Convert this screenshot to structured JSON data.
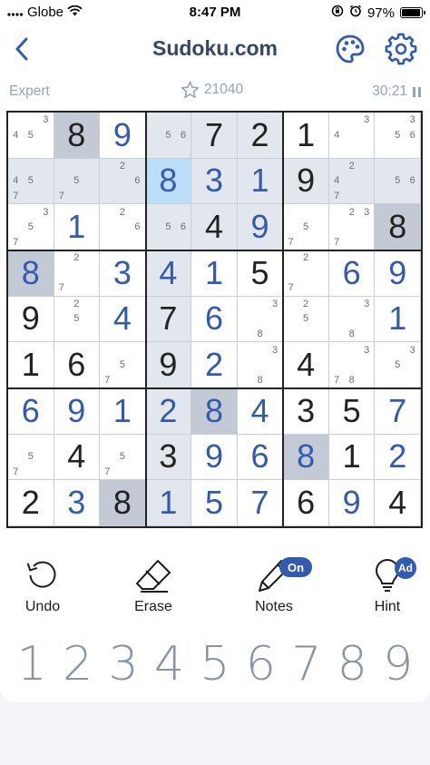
{
  "status_bar": {
    "carrier": "Globe",
    "time": "8:47 PM",
    "battery": "97%",
    "battery_level": 0.97
  },
  "header": {
    "title_main": "Sudoku",
    "title_dot": ".",
    "title_tld": "com"
  },
  "info": {
    "difficulty": "Expert",
    "score": "21040",
    "timer": "30:21"
  },
  "colors": {
    "brand": "#325aaf",
    "given": "#222222",
    "user": "#325aaf",
    "highlight": "#e2e7ed",
    "selected": "#bbdefb",
    "same_number": "#c3cad6"
  },
  "board": {
    "cells": [
      [
        {
          "notes": [
            "4",
            "5",
            "",
            "",
            "",
            "",
            ""
          ],
          "n3": "3"
        },
        {
          "v": "8",
          "t": "given"
        },
        {
          "v": "9",
          "t": "user"
        },
        {
          "notes6": [
            "5",
            "6"
          ]
        },
        {
          "v": "7",
          "t": "given"
        },
        {
          "v": "2",
          "t": "given"
        },
        {
          "v": "1",
          "t": "given"
        },
        {
          "notes": [
            "4"
          ],
          "n3": "3"
        },
        {
          "n3": "3",
          "notes6": [
            "5",
            "6"
          ]
        }
      ],
      [
        {
          "full": "4 5 7"
        },
        {
          "full": "5 7"
        },
        {
          "full": "2 6"
        },
        {
          "v": "8",
          "t": "user"
        },
        {
          "v": "3",
          "t": "user"
        },
        {
          "v": "1",
          "t": "user"
        },
        {
          "v": "9",
          "t": "given"
        },
        {
          "full": "2 4 7"
        },
        {
          "full": "5 6"
        }
      ],
      [
        {
          "full": "3 5 7"
        },
        {
          "v": "1",
          "t": "user"
        },
        {
          "full": "2 6"
        },
        {
          "full": "5 6"
        },
        {
          "v": "4",
          "t": "given"
        },
        {
          "v": "9",
          "t": "user"
        },
        {
          "full": "5 7"
        },
        {
          "full": "2 3 7"
        },
        {
          "v": "8",
          "t": "given"
        }
      ],
      [
        {
          "v": "8",
          "t": "user"
        },
        {
          "full": "2 7"
        },
        {
          "v": "3",
          "t": "user"
        },
        {
          "v": "4",
          "t": "user"
        },
        {
          "v": "1",
          "t": "user"
        },
        {
          "v": "5",
          "t": "given"
        },
        {
          "full": "2 7"
        },
        {
          "v": "6",
          "t": "user"
        },
        {
          "v": "9",
          "t": "user"
        }
      ],
      [
        {
          "v": "9",
          "t": "given"
        },
        {
          "full": "2 5"
        },
        {
          "v": "4",
          "t": "user"
        },
        {
          "v": "7",
          "t": "given"
        },
        {
          "v": "6",
          "t": "user"
        },
        {
          "full": "3 8"
        },
        {
          "full": "2 5"
        },
        {
          "full": "3 8"
        },
        {
          "v": "1",
          "t": "user"
        }
      ],
      [
        {
          "v": "1",
          "t": "given"
        },
        {
          "v": "6",
          "t": "given"
        },
        {
          "full": "5 7"
        },
        {
          "v": "9",
          "t": "given"
        },
        {
          "v": "2",
          "t": "user"
        },
        {
          "full": "3 8"
        },
        {
          "v": "4",
          "t": "given"
        },
        {
          "full": "3 7 8"
        },
        {
          "full": "3 5"
        }
      ],
      [
        {
          "v": "6",
          "t": "user"
        },
        {
          "v": "9",
          "t": "user"
        },
        {
          "v": "1",
          "t": "user"
        },
        {
          "v": "2",
          "t": "user"
        },
        {
          "v": "8",
          "t": "user"
        },
        {
          "v": "4",
          "t": "user"
        },
        {
          "v": "3",
          "t": "given"
        },
        {
          "v": "5",
          "t": "given"
        },
        {
          "v": "7",
          "t": "user"
        }
      ],
      [
        {
          "full": "5 7"
        },
        {
          "v": "4",
          "t": "given"
        },
        {
          "full": "5 7"
        },
        {
          "v": "3",
          "t": "given"
        },
        {
          "v": "9",
          "t": "user"
        },
        {
          "v": "6",
          "t": "user"
        },
        {
          "v": "8",
          "t": "user"
        },
        {
          "v": "1",
          "t": "given"
        },
        {
          "v": "2",
          "t": "user"
        }
      ],
      [
        {
          "v": "2",
          "t": "given"
        },
        {
          "v": "3",
          "t": "user"
        },
        {
          "v": "8",
          "t": "given"
        },
        {
          "v": "1",
          "t": "user"
        },
        {
          "v": "5",
          "t": "user"
        },
        {
          "v": "7",
          "t": "user"
        },
        {
          "v": "6",
          "t": "given"
        },
        {
          "v": "9",
          "t": "user"
        },
        {
          "v": "4",
          "t": "given"
        }
      ]
    ],
    "highlight": {
      "selected": [
        [
          1,
          3
        ]
      ],
      "same_number": [
        [
          0,
          1
        ],
        [
          3,
          0
        ],
        [
          2,
          8
        ],
        [
          6,
          4
        ],
        [
          7,
          6
        ],
        [
          8,
          2
        ]
      ],
      "related": [
        [
          0,
          3
        ],
        [
          0,
          4
        ],
        [
          0,
          5
        ],
        [
          1,
          4
        ],
        [
          1,
          5
        ],
        [
          2,
          3
        ],
        [
          2,
          4
        ],
        [
          2,
          5
        ],
        [
          1,
          0
        ],
        [
          1,
          1
        ],
        [
          1,
          2
        ],
        [
          1,
          6
        ],
        [
          1,
          7
        ],
        [
          1,
          8
        ],
        [
          3,
          3
        ],
        [
          4,
          3
        ],
        [
          5,
          3
        ],
        [
          6,
          3
        ],
        [
          7,
          3
        ],
        [
          8,
          3
        ]
      ]
    }
  },
  "tools": {
    "undo": "Undo",
    "erase": "Erase",
    "notes": "Notes",
    "notes_badge": "On",
    "hint": "Hint",
    "hint_badge": "Ad"
  },
  "numpad": [
    "1",
    "2",
    "3",
    "4",
    "5",
    "6",
    "7",
    "8",
    "9"
  ]
}
